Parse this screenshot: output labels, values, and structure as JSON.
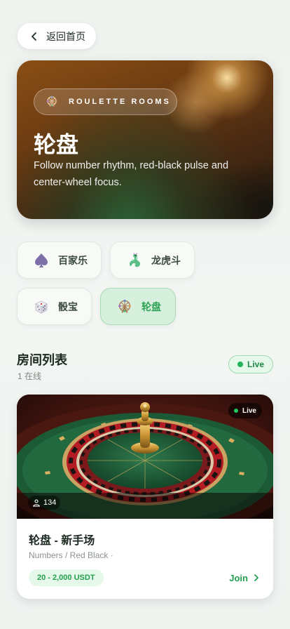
{
  "back": {
    "label": "返回首页",
    "icon": "chevron-left-icon"
  },
  "hero": {
    "badge_icon": "ferris-wheel-icon",
    "badge": "ROULETTE ROOMS",
    "title": "轮盘",
    "desc": "Follow number rhythm, red-black pulse and center-wheel focus."
  },
  "categories": [
    {
      "label": "百家乐",
      "icon": "spade-icon",
      "active": false
    },
    {
      "label": "龙虎斗",
      "icon": "dragon-icon",
      "active": false
    },
    {
      "label": "骰宝",
      "icon": "dice-icon",
      "active": false
    },
    {
      "label": "轮盘",
      "icon": "ferris-wheel-icon",
      "active": true
    }
  ],
  "rooms_section": {
    "title": "房间列表",
    "online": "1 在线",
    "live_label": "Live"
  },
  "room": {
    "live_label": "Live",
    "players": "134",
    "name": "轮盘 - 新手场",
    "tags": "Numbers / Red Black ·",
    "limit": "20 - 2,000 USDT",
    "join_label": "Join"
  },
  "colors": {
    "accent_green": "#22a04e",
    "active_bg": "#d7efdd",
    "hero_brown": "#6d3c12"
  }
}
